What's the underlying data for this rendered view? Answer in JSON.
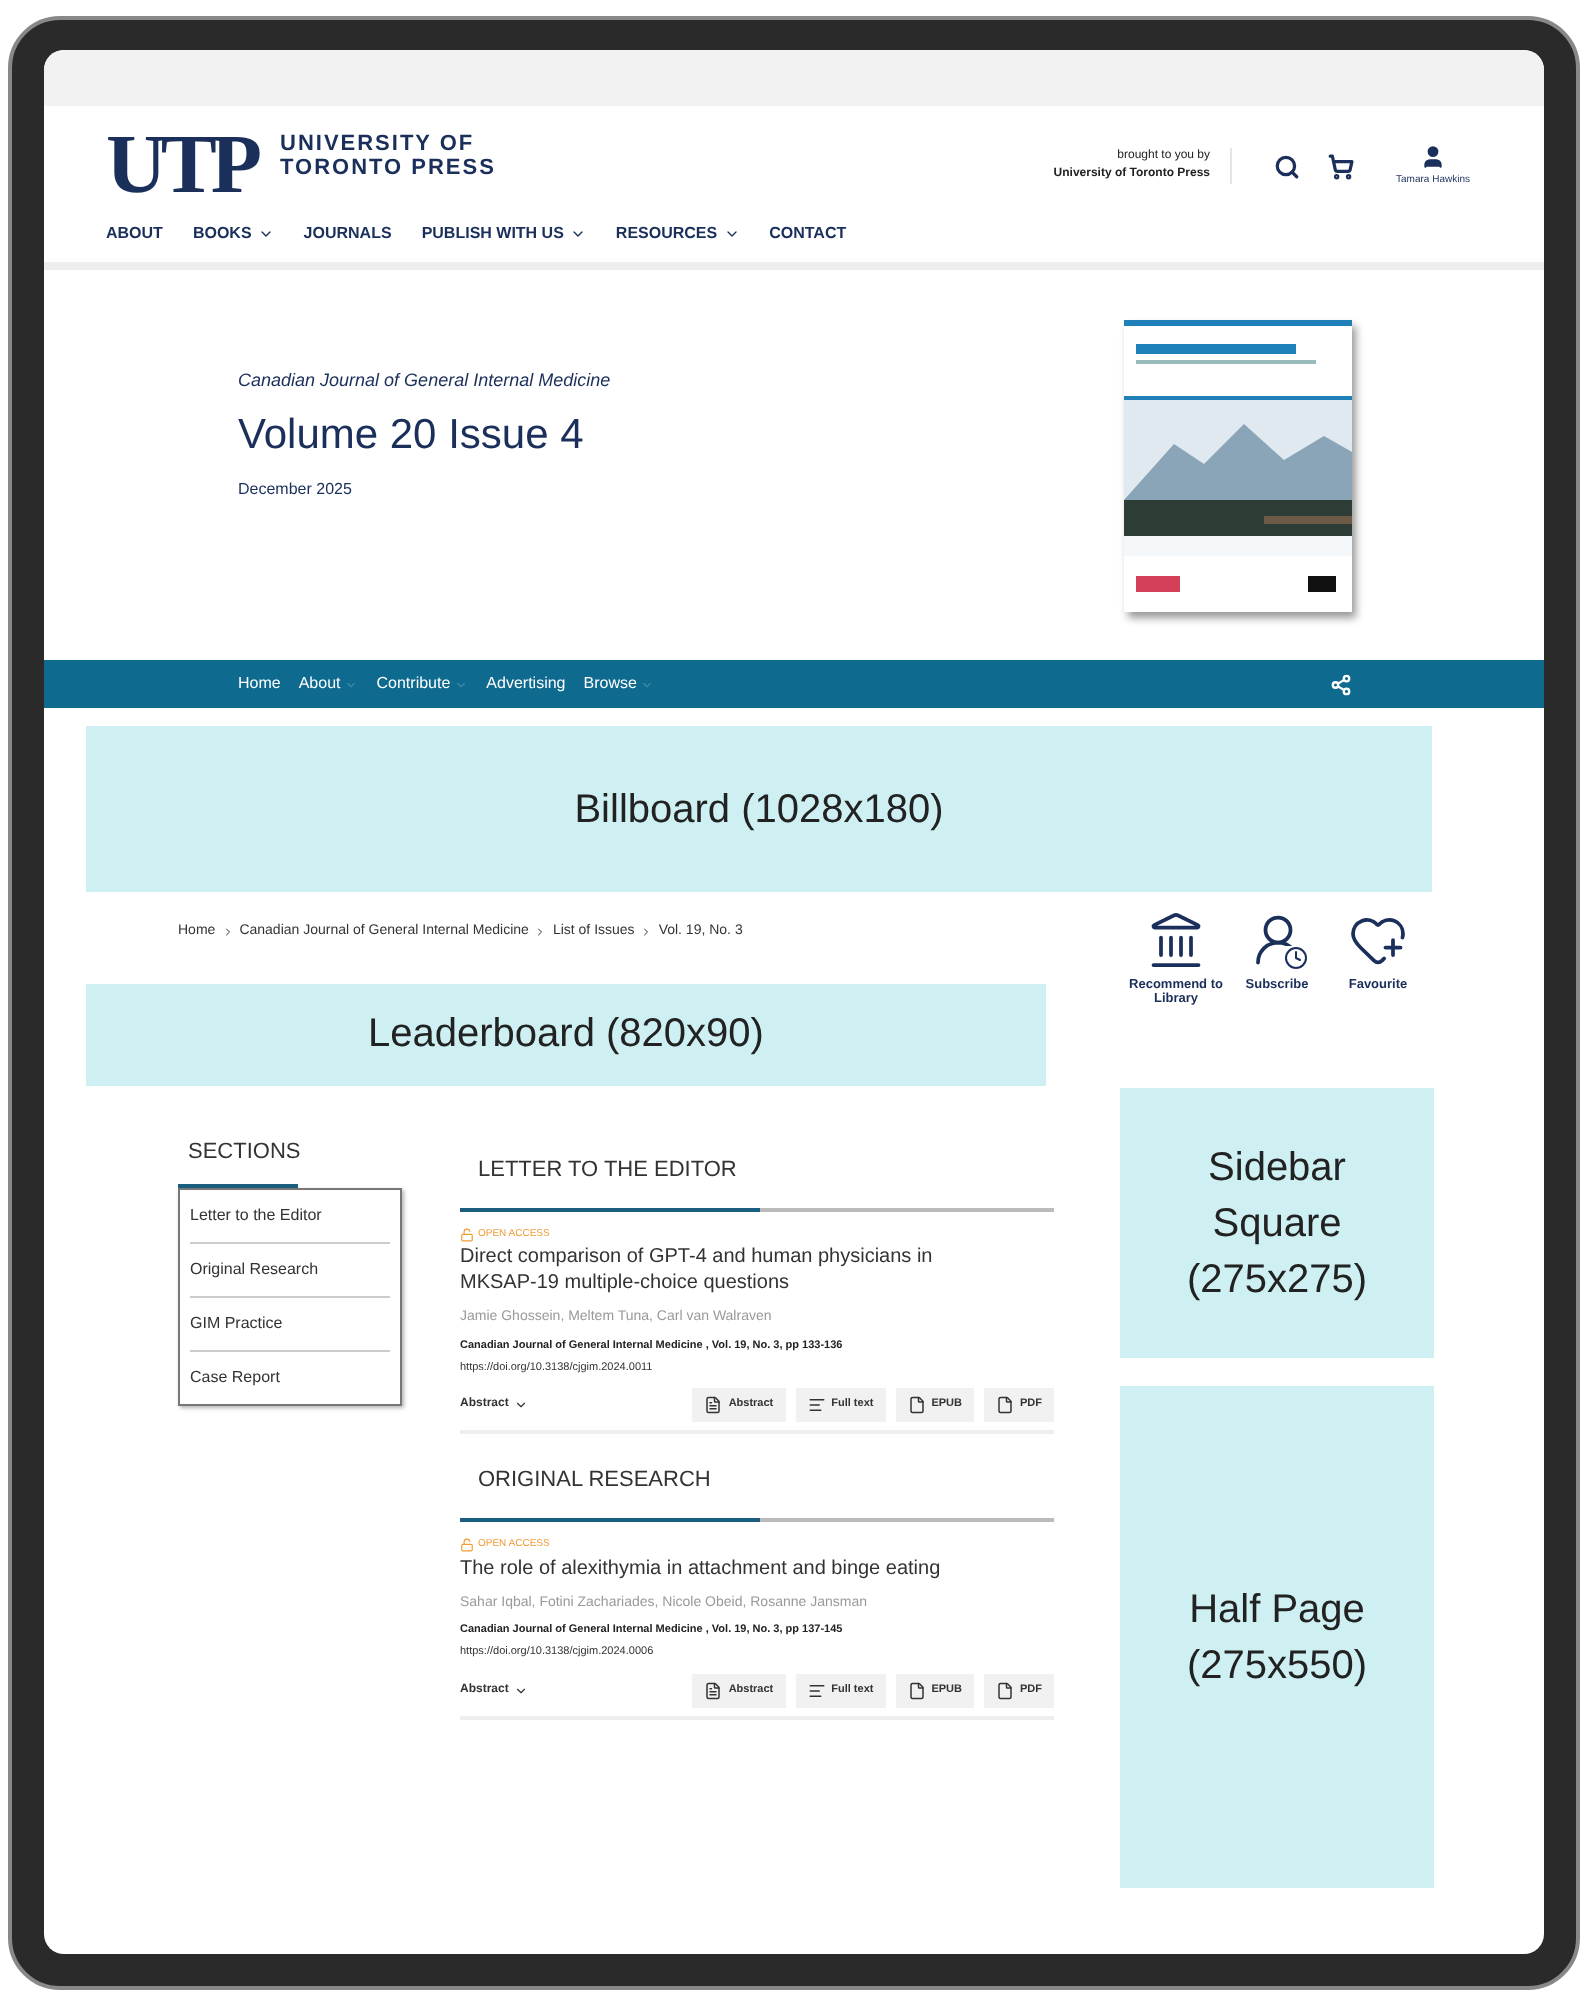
{
  "header": {
    "logo_mark": "UTP",
    "logo_text": [
      "UNIVERSITY OF",
      "TORONTO PRESS"
    ],
    "brought_by": [
      "brought to you by",
      "University of Toronto Press"
    ],
    "user_name": "Tamara Hawkins",
    "nav": [
      {
        "label": "ABOUT",
        "has_dropdown": false
      },
      {
        "label": "BOOKS",
        "has_dropdown": true
      },
      {
        "label": "JOURNALS",
        "has_dropdown": false
      },
      {
        "label": "PUBLISH WITH US",
        "has_dropdown": true
      },
      {
        "label": "RESOURCES",
        "has_dropdown": true
      },
      {
        "label": "CONTACT",
        "has_dropdown": false
      }
    ]
  },
  "hero": {
    "journal": "Canadian Journal of General Internal Medicine",
    "title": "Volume 20 Issue 4",
    "date": "December 2025"
  },
  "journal_nav": [
    {
      "label": "Home",
      "has_dropdown": false
    },
    {
      "label": "About",
      "has_dropdown": true
    },
    {
      "label": "Contribute",
      "has_dropdown": true
    },
    {
      "label": "Advertising",
      "has_dropdown": false
    },
    {
      "label": "Browse",
      "has_dropdown": true
    }
  ],
  "ads": {
    "billboard": "Billboard (1028x180)",
    "leaderboard": "Leaderboard (820x90)",
    "sidebar_square": "Sidebar Square (275x275)",
    "half_page": "Half Page (275x550)"
  },
  "breadcrumb": [
    "Home",
    "Canadian Journal of General Internal Medicine",
    "List of Issues",
    "Vol. 19, No. 3"
  ],
  "actions": [
    {
      "kind": "library",
      "label": "Recommend to Library"
    },
    {
      "kind": "subscribe",
      "label": "Subscribe"
    },
    {
      "kind": "favourite",
      "label": "Favourite"
    }
  ],
  "sections": {
    "title": "SECTIONS",
    "items": [
      "Letter to the Editor",
      "Original Research",
      "GIM Practice",
      "Case Report"
    ]
  },
  "article_groups": [
    {
      "heading": "LETTER TO THE EDITOR",
      "articles": [
        {
          "access": "OPEN ACCESS",
          "title": "Direct comparison of GPT-4 and human physicians in MKSAP-19 multiple-choice questions",
          "authors": "Jamie Ghossein, Meltem Tuna, Carl van Walraven",
          "citation": "Canadian Journal of General Internal Medicine , Vol. 19, No. 3, pp 133-136",
          "doi": "https://doi.org/10.3138/cjgim.2024.0011",
          "abstract_toggle": "Abstract",
          "buttons": [
            {
              "kind": "abstract",
              "label": "Abstract"
            },
            {
              "kind": "fulltext",
              "label": "Full text"
            },
            {
              "kind": "epub",
              "label": "EPUB"
            },
            {
              "kind": "pdf",
              "label": "PDF"
            }
          ]
        }
      ]
    },
    {
      "heading": "ORIGINAL RESEARCH",
      "articles": [
        {
          "access": "OPEN ACCESS",
          "title": "The role of alexithymia in attachment and binge eating",
          "authors": "Sahar Iqbal, Fotini Zachariades, Nicole Obeid, Rosanne Jansman",
          "citation": "Canadian Journal of General Internal Medicine , Vol. 19, No. 3, pp 137-145",
          "doi": "https://doi.org/10.3138/cjgim.2024.0006",
          "abstract_toggle": "Abstract",
          "buttons": [
            {
              "kind": "abstract",
              "label": "Abstract"
            },
            {
              "kind": "fulltext",
              "label": "Full text"
            },
            {
              "kind": "epub",
              "label": "EPUB"
            },
            {
              "kind": "pdf",
              "label": "PDF"
            }
          ]
        }
      ]
    }
  ]
}
